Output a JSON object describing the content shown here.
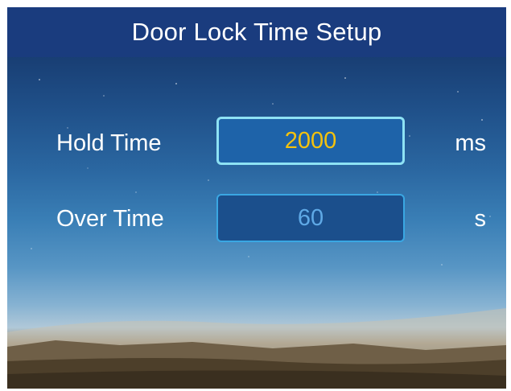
{
  "header": {
    "title": "Door Lock Time Setup"
  },
  "settings": [
    {
      "label": "Hold Time",
      "value": "2000",
      "unit": "ms",
      "focused": true
    },
    {
      "label": "Over Time",
      "value": "60",
      "unit": "s",
      "focused": false
    }
  ],
  "colors": {
    "title_bar": "#1a3c7e",
    "active_value": "#f4c20d",
    "inactive_value": "#5fa9e6",
    "active_border": "#8ee2f4",
    "inactive_border": "#3aa7e3"
  }
}
